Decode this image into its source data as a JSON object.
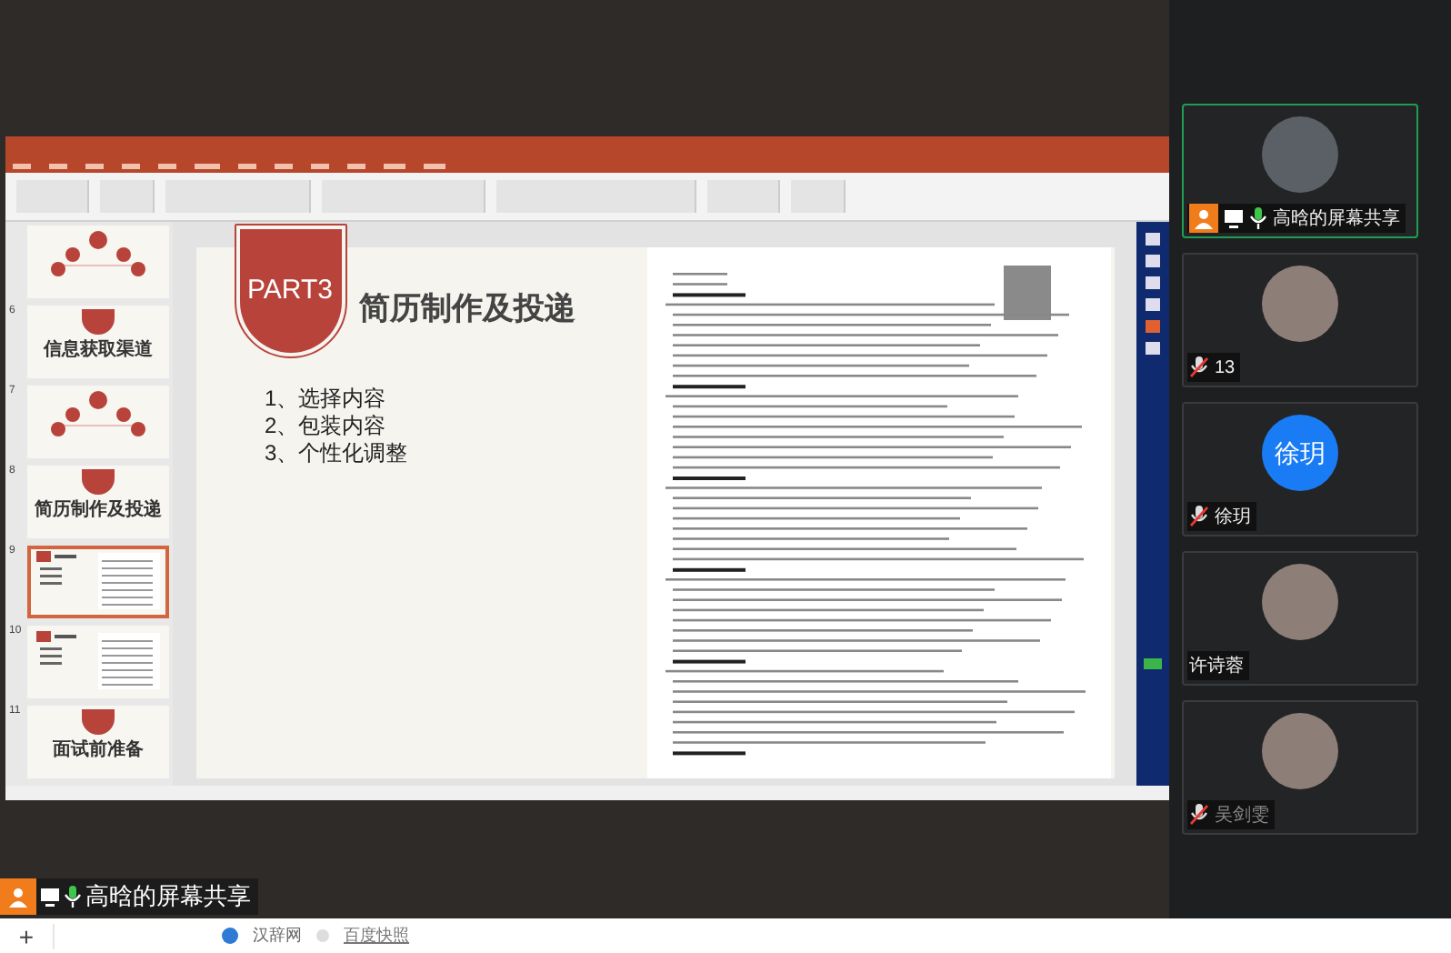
{
  "share_label": {
    "text": "高晗的屏幕共享"
  },
  "thumbnails": [
    {
      "kind": "diagram",
      "selected": false
    },
    {
      "number": "6",
      "kind": "section",
      "title": "信息获取渠道",
      "selected": false
    },
    {
      "number": "7",
      "kind": "diagram",
      "selected": false
    },
    {
      "number": "8",
      "kind": "section",
      "title": "简历制作及投递",
      "selected": false
    },
    {
      "number": "9",
      "kind": "content",
      "selected": true
    },
    {
      "number": "10",
      "kind": "content",
      "selected": false
    },
    {
      "number": "11",
      "kind": "section",
      "title": "面试前准备",
      "selected": false
    }
  ],
  "slide": {
    "badge": "PART3",
    "title": "简历制作及投递",
    "items": [
      "1、选择内容",
      "2、包装内容",
      "3、个性化调整"
    ]
  },
  "participants": [
    {
      "name": "高晗的屏幕共享",
      "kind": "sharer",
      "mic_visible": true,
      "muted": false,
      "dimmed": false,
      "selected": true
    },
    {
      "name": "13",
      "kind": "photo",
      "mic_visible": true,
      "muted": true,
      "dimmed": false,
      "selected": false
    },
    {
      "name": "徐玥",
      "kind": "initials",
      "avatar_text": "徐玥",
      "mic_visible": true,
      "muted": true,
      "dimmed": false,
      "selected": false
    },
    {
      "name": "许诗蓉",
      "kind": "photo",
      "mic_visible": false,
      "dimmed": false,
      "selected": false
    },
    {
      "name": "吴剑雯",
      "kind": "photo",
      "mic_visible": true,
      "muted": true,
      "dimmed": true,
      "selected": false
    }
  ],
  "browser_bar": {
    "add": "+",
    "links": [
      "汉辞网",
      "百度快照"
    ]
  }
}
